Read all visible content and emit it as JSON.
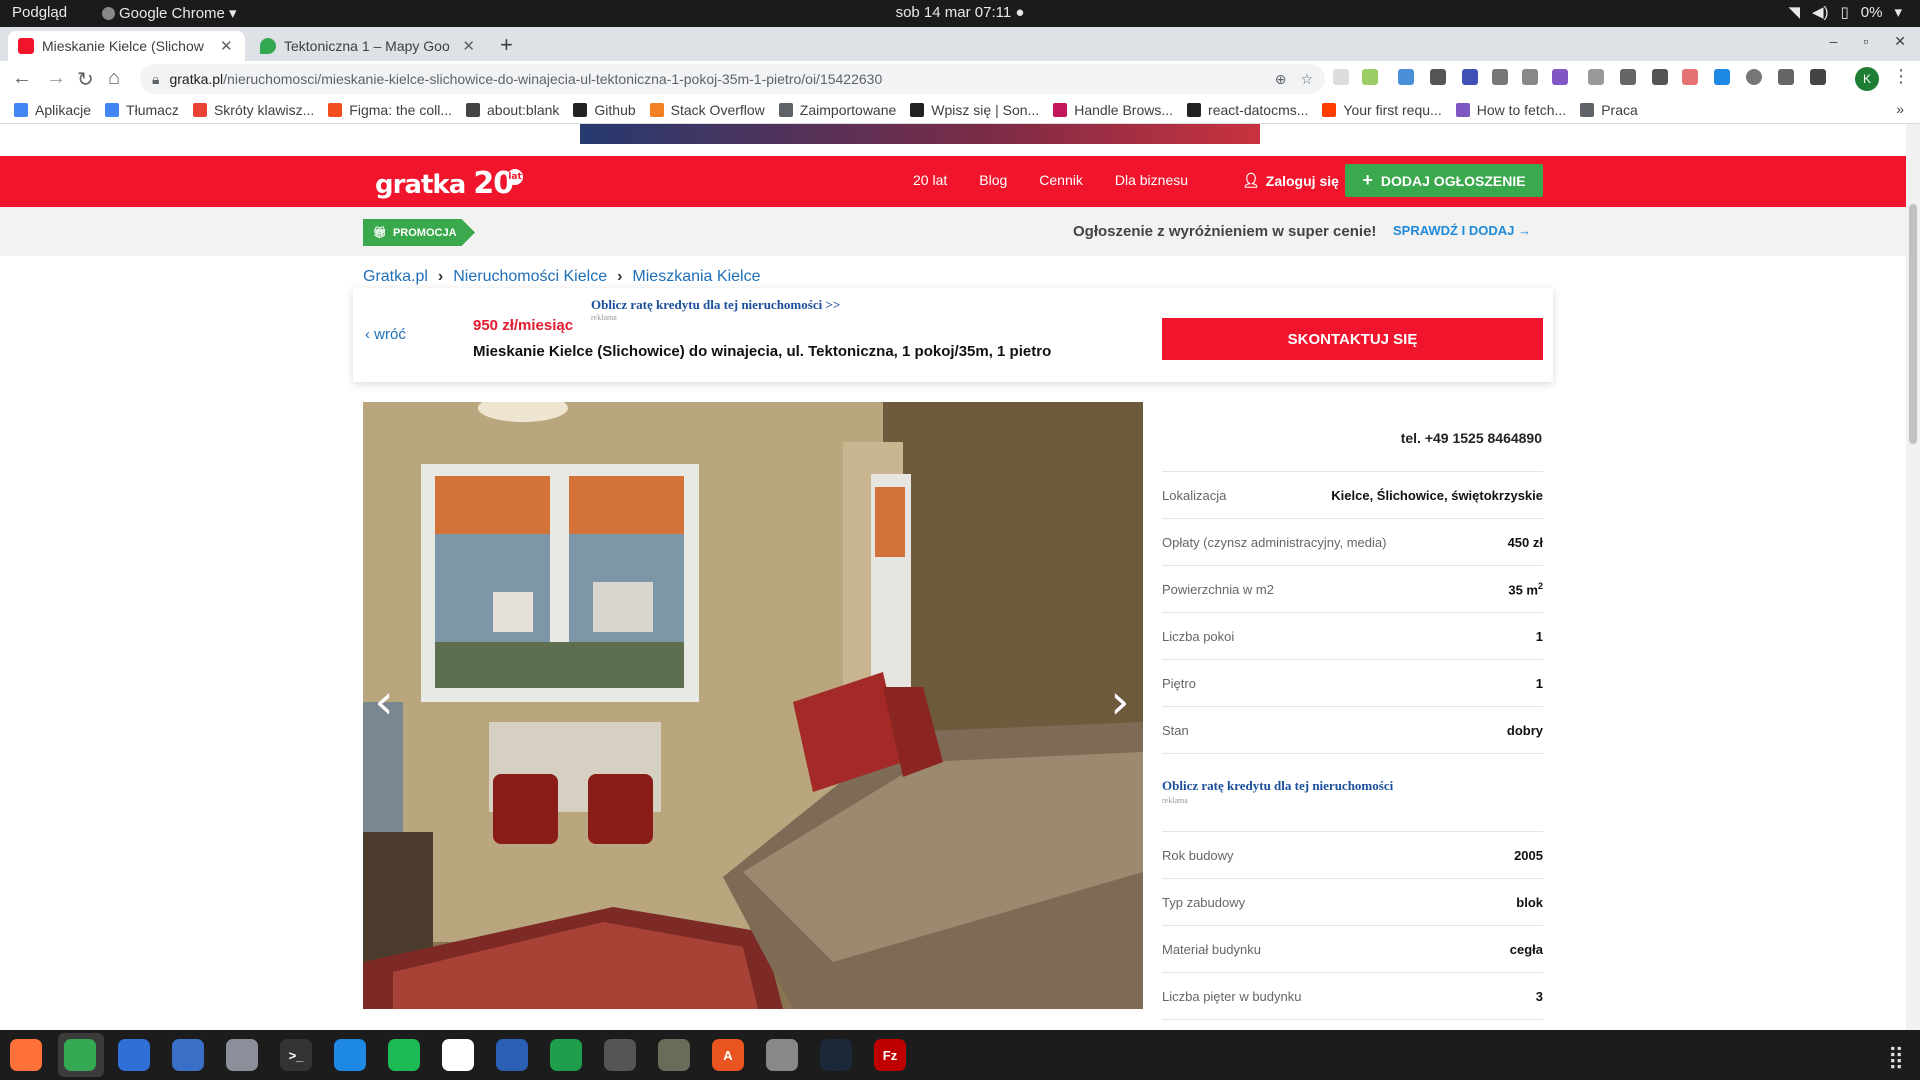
{
  "os": {
    "app_preview": "Podgląd",
    "app_chrome": "Google Chrome",
    "clock": "sob 14 mar  07:11",
    "battery": "0%"
  },
  "tabs": [
    {
      "title": "Mieskanie Kielce (Slichow",
      "favicon_color": "#f0142d",
      "active": true
    },
    {
      "title": "Tektoniczna 1 – Mapy Goo",
      "favicon_color": "#34a853",
      "active": false
    }
  ],
  "omnibox": {
    "domain": "gratka.pl",
    "path": "/nieruchomosci/mieskanie-kielce-slichowice-do-winajecia-ul-tektoniczna-1-pokoj-35m-1-pietro/oi/15422630"
  },
  "profile_initial": "K",
  "bookmarks": [
    {
      "label": "Aplikacje",
      "color": "#4285f4"
    },
    {
      "label": "Tłumacz",
      "color": "#4285f4"
    },
    {
      "label": "Skróty klawisz...",
      "color": "#ea4335"
    },
    {
      "label": "Figma: the coll...",
      "color": "#f24e1e"
    },
    {
      "label": "about:blank",
      "color": "#444444"
    },
    {
      "label": "Github",
      "color": "#222222"
    },
    {
      "label": "Stack Overflow",
      "color": "#f48024"
    },
    {
      "label": "Zaimportowane",
      "color": "#5f6368"
    },
    {
      "label": "Wpisz się | Son...",
      "color": "#222222"
    },
    {
      "label": "Handle Brows...",
      "color": "#c2185b"
    },
    {
      "label": "react-datocms...",
      "color": "#222222"
    },
    {
      "label": "Your first requ...",
      "color": "#ff3d00"
    },
    {
      "label": "How to fetch...",
      "color": "#7e57c2"
    },
    {
      "label": "Praca",
      "color": "#5f6368"
    }
  ],
  "site": {
    "logo_text": "gratka",
    "logo_20": "20",
    "logo_lat": "lat",
    "nav": [
      "20 lat",
      "Blog",
      "Cennik",
      "Dla biznesu"
    ],
    "login": "Zaloguj się",
    "add_button": "DODAJ OGŁOSZENIE",
    "accent_color": "#f0142d",
    "green_color": "#3aa84c"
  },
  "promo": {
    "tag": "PROMOCJA",
    "text": "Ogłoszenie z wyróżnieniem w super cenie!",
    "link": "SPRAWDŹ I DODAJ"
  },
  "breadcrumb": [
    "Gratka.pl",
    "Nieruchomości Kielce",
    "Mieszkania Kielce"
  ],
  "offer": {
    "back": "wróć",
    "price": "950 zł/miesiąc",
    "credit_link": "Oblicz ratę kredytu dla tej nieruchomości >>",
    "credit_ad": "reklama",
    "title": "Mieskanie Kielce (Slichowice) do winajecia, ul. Tektoniczna, 1 pokoj/35m, 1 pietro",
    "contact": "SKONTAKTUJ SIĘ",
    "phone": "tel. +49 1525 8464890"
  },
  "attributes_top": [
    {
      "label": "Lokalizacja",
      "value": "Kielce, Ślichowice, świętokrzyskie"
    },
    {
      "label": "Opłaty (czynsz administracyjny, media)",
      "value": "450 zł"
    },
    {
      "label": "Powierzchnia w m2",
      "value": "35 m",
      "sup": "2"
    },
    {
      "label": "Liczba pokoi",
      "value": "1"
    },
    {
      "label": "Piętro",
      "value": "1"
    },
    {
      "label": "Stan",
      "value": "dobry"
    }
  ],
  "credit_box": {
    "link": "Oblicz ratę kredytu dla tej nieruchomości",
    "ad": "reklama"
  },
  "attributes_bottom": [
    {
      "label": "Rok budowy",
      "value": "2005"
    },
    {
      "label": "Typ zabudowy",
      "value": "blok"
    },
    {
      "label": "Materiał budynku",
      "value": "cegła"
    },
    {
      "label": "Liczba pięter w budynku",
      "value": "3"
    }
  ],
  "dock": [
    {
      "name": "firefox-icon",
      "color": "#ff7139",
      "glyph": ""
    },
    {
      "name": "chrome-icon",
      "color": "#34a853",
      "glyph": ""
    },
    {
      "name": "thunderbird-icon",
      "color": "#2f6fd6",
      "glyph": ""
    },
    {
      "name": "writer-icon",
      "color": "#3a6fc8",
      "glyph": ""
    },
    {
      "name": "files-icon",
      "color": "#8a8f99",
      "glyph": ""
    },
    {
      "name": "terminal-icon",
      "color": "#333333",
      "glyph": ">_"
    },
    {
      "name": "vscode-icon",
      "color": "#1e88e5",
      "glyph": ""
    },
    {
      "name": "spotify-icon",
      "color": "#1db954",
      "glyph": ""
    },
    {
      "name": "slack-icon",
      "color": "#ffffff",
      "glyph": ""
    },
    {
      "name": "libreoffice-writer-icon",
      "color": "#2a5fb4",
      "glyph": ""
    },
    {
      "name": "calc-icon",
      "color": "#1e9e4a",
      "glyph": ""
    },
    {
      "name": "inkscape-icon",
      "color": "#555555",
      "glyph": ""
    },
    {
      "name": "gimp-icon",
      "color": "#6b6b5a",
      "glyph": ""
    },
    {
      "name": "software-store-icon",
      "color": "#e95420",
      "glyph": "A"
    },
    {
      "name": "settings-icon",
      "color": "#888888",
      "glyph": ""
    },
    {
      "name": "steam-icon",
      "color": "#1b2838",
      "glyph": ""
    },
    {
      "name": "filezilla-icon",
      "color": "#bf0000",
      "glyph": "Fz"
    }
  ]
}
